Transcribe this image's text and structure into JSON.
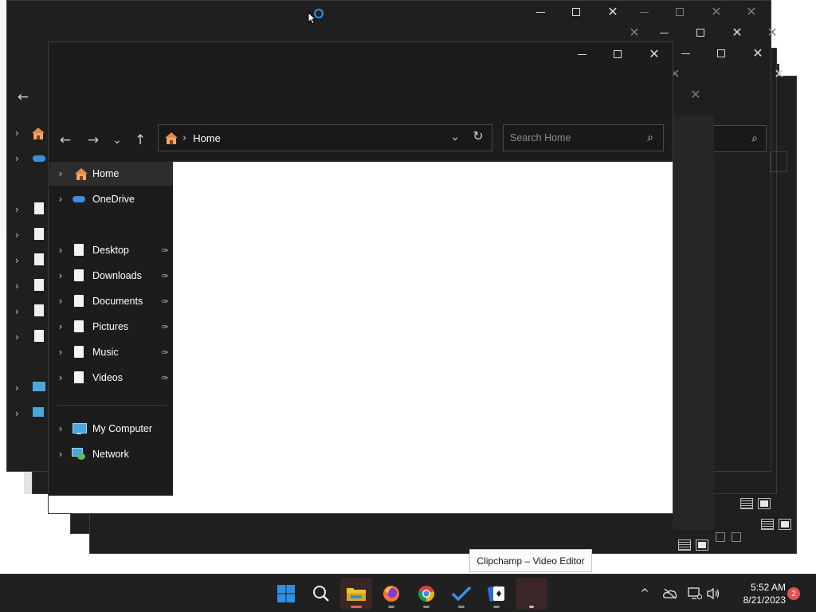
{
  "main_window": {
    "address": {
      "breadcrumb": "Home",
      "separator": "›"
    },
    "search": {
      "placeholder": "Search Home"
    },
    "nav_glyphs": {
      "back": "←",
      "forward": "→",
      "recent": "⌄",
      "up": "↑",
      "dropdown": "⌄",
      "refresh": "↻",
      "search": "⌕"
    },
    "nav_pane": {
      "items": [
        {
          "label": "Home",
          "icon": "home-icon",
          "selected": true
        },
        {
          "label": "OneDrive",
          "icon": "onedrive-icon"
        },
        {
          "label": "Desktop",
          "icon": "document-icon",
          "pinned": true
        },
        {
          "label": "Downloads",
          "icon": "document-icon",
          "pinned": true
        },
        {
          "label": "Documents",
          "icon": "document-icon",
          "pinned": true
        },
        {
          "label": "Pictures",
          "icon": "document-icon",
          "pinned": true
        },
        {
          "label": "Music",
          "icon": "document-icon",
          "pinned": true
        },
        {
          "label": "Videos",
          "icon": "document-icon",
          "pinned": true
        },
        {
          "label": "My Computer",
          "icon": "monitor-icon"
        },
        {
          "label": "Network",
          "icon": "network-icon"
        }
      ],
      "pin_glyph": "📌",
      "chevron": "›"
    }
  },
  "window_controls": {
    "minimize": "—",
    "maximize": "☐",
    "close": "✕"
  },
  "tooltip": {
    "text": "Clipchamp – Video Editor"
  },
  "taskbar": {
    "apps": [
      "windows-start",
      "search",
      "file-explorer",
      "firefox",
      "chrome",
      "microsoft-todo",
      "solitaire",
      "clipchamp"
    ],
    "tray": {
      "chevron": "^"
    },
    "clock": {
      "time": "5:52 AM",
      "date": "8/21/2023"
    },
    "notifications": "2"
  },
  "colors": {
    "window_bg": "#1c1c1c",
    "taskbar_bg": "#202020",
    "accent": "#0078d4",
    "home_icon": "#e58a4a"
  }
}
